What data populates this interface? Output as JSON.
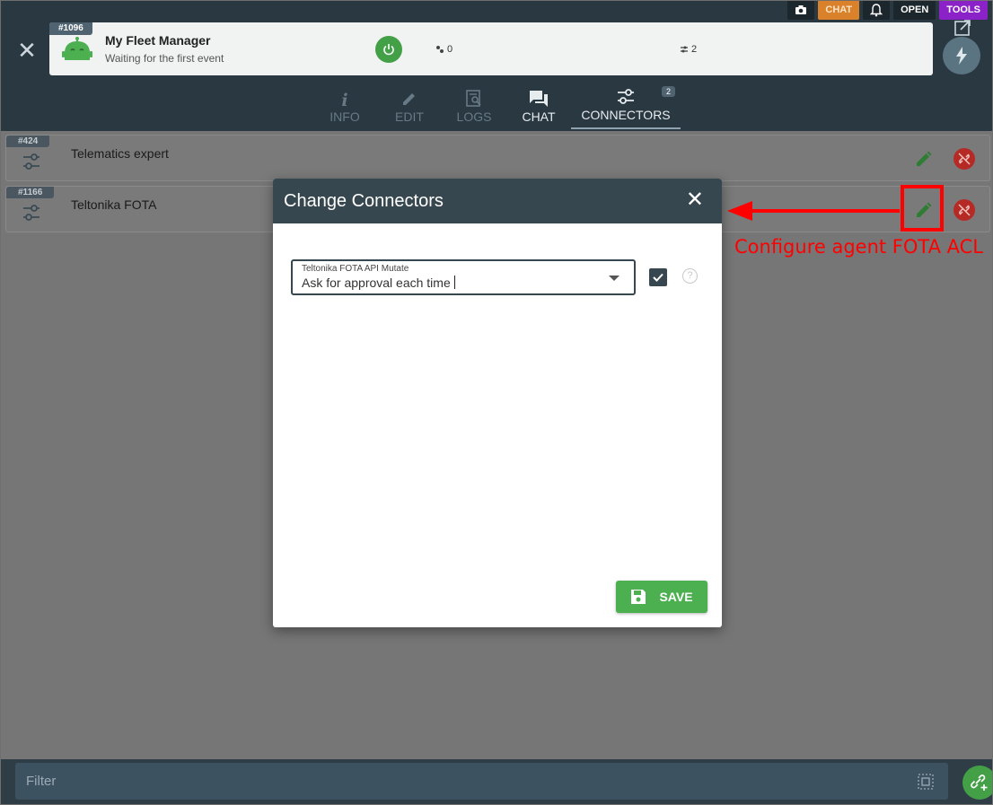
{
  "toolbar": {
    "chat_label": "CHAT",
    "open_label": "OPEN",
    "tools_label": "TOOLS",
    "icons": [
      "camera-icon",
      "bell-icon"
    ],
    "colors": {
      "chat": "#d9822b",
      "tools": "#8b22c7"
    }
  },
  "agent": {
    "id": "#1096",
    "name": "My Fleet Manager",
    "status": "Waiting for the first event",
    "stat_a": "0",
    "stat_b": "2"
  },
  "tabs": [
    {
      "label": "INFO",
      "icon": "info-icon"
    },
    {
      "label": "EDIT",
      "icon": "pencil-icon"
    },
    {
      "label": "LOGS",
      "icon": "logs-icon"
    },
    {
      "label": "CHAT",
      "icon": "chat-icon"
    },
    {
      "label": "CONNECTORS",
      "icon": "connectors-icon",
      "badge": "2"
    }
  ],
  "connectors": [
    {
      "id": "#424",
      "name": "Telematics expert"
    },
    {
      "id": "#1166",
      "name": "Teltonika FOTA"
    }
  ],
  "annotation": {
    "text": "Configure agent FOTA ACL",
    "color": "#ff0000"
  },
  "dialog": {
    "title": "Change Connectors",
    "field_label": "Teltonika FOTA API Mutate",
    "field_value": "Ask for approval each time",
    "help": "?",
    "save_label": "SAVE"
  },
  "footer": {
    "filter_placeholder": "Filter"
  }
}
